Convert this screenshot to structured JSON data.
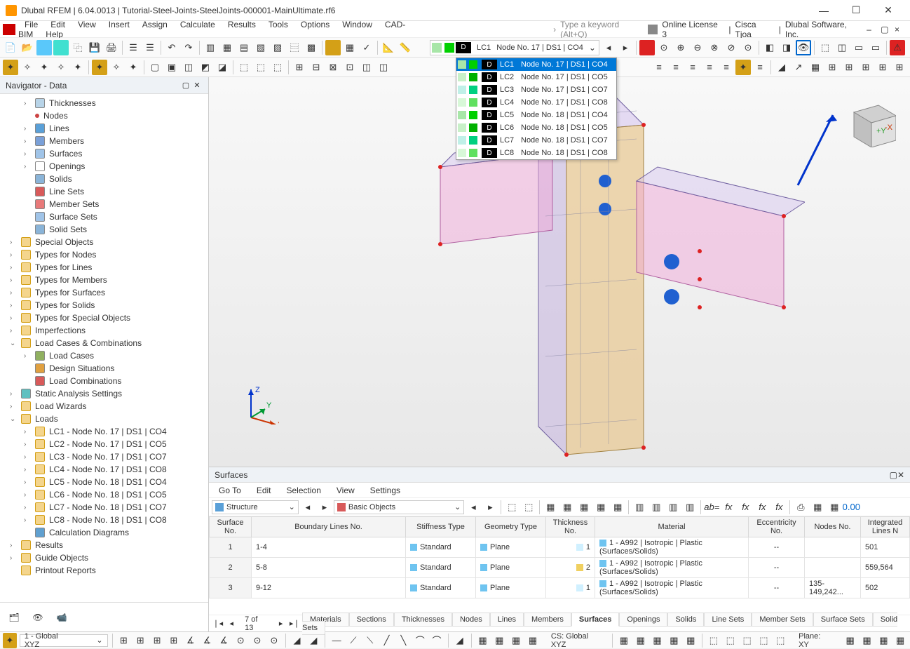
{
  "titlebar": {
    "title": "Dlubal RFEM | 6.04.0013 | Tutorial-Steel-Joints-SteelJoints-000001-MainUltimate.rf6"
  },
  "menubar": {
    "items": [
      "File",
      "Edit",
      "View",
      "Insert",
      "Assign",
      "Calculate",
      "Results",
      "Tools",
      "Options",
      "Window",
      "CAD-BIM",
      "Help"
    ],
    "search_placeholder": "Type a keyword (Alt+Q)",
    "license": "Online License 3",
    "user": "Cisca Tjoa",
    "company": "Dlubal Software, Inc."
  },
  "lc_selector": {
    "current_id": "LC1",
    "current_text": "Node No. 17 | DS1 | CO4",
    "options": [
      {
        "id": "LC1",
        "text": "Node No. 17 | DS1 | CO4",
        "sw1": "#a8e6a8",
        "sw2": "#00d000"
      },
      {
        "id": "LC2",
        "text": "Node No. 17 | DS1 | CO5",
        "sw1": "#c8f0c8",
        "sw2": "#00b000"
      },
      {
        "id": "LC3",
        "text": "Node No. 17 | DS1 | CO7",
        "sw1": "#c0f0e8",
        "sw2": "#00d080"
      },
      {
        "id": "LC4",
        "text": "Node No. 17 | DS1 | CO8",
        "sw1": "#d8f8d8",
        "sw2": "#60e060"
      },
      {
        "id": "LC5",
        "text": "Node No. 18 | DS1 | CO4",
        "sw1": "#a8e6a8",
        "sw2": "#00d000"
      },
      {
        "id": "LC6",
        "text": "Node No. 18 | DS1 | CO5",
        "sw1": "#c8f0c8",
        "sw2": "#00b000"
      },
      {
        "id": "LC7",
        "text": "Node No. 18 | DS1 | CO7",
        "sw1": "#c0f0e8",
        "sw2": "#00d080"
      },
      {
        "id": "LC8",
        "text": "Node No. 18 | DS1 | CO8",
        "sw1": "#d8f8d8",
        "sw2": "#60e060"
      }
    ]
  },
  "navigator": {
    "title": "Navigator - Data",
    "tree": [
      {
        "d": 2,
        "label": "Thicknesses",
        "chev": "›",
        "ic": "#b8d4e8"
      },
      {
        "d": 2,
        "label": "Nodes",
        "ic": "node"
      },
      {
        "d": 2,
        "label": "Lines",
        "chev": "›",
        "ic": "#5aa0d8"
      },
      {
        "d": 2,
        "label": "Members",
        "chev": "›",
        "ic": "#7aa0d8"
      },
      {
        "d": 2,
        "label": "Surfaces",
        "chev": "›",
        "ic": "#a0c4e8"
      },
      {
        "d": 2,
        "label": "Openings",
        "chev": "›",
        "ic": "#ffffff"
      },
      {
        "d": 2,
        "label": "Solids",
        "ic": "#8ab4d8"
      },
      {
        "d": 2,
        "label": "Line Sets",
        "ic": "#d85a5a"
      },
      {
        "d": 2,
        "label": "Member Sets",
        "ic": "#e87a7a"
      },
      {
        "d": 2,
        "label": "Surface Sets",
        "ic": "#a0c4e8"
      },
      {
        "d": 2,
        "label": "Solid Sets",
        "ic": "#8ab4d8"
      },
      {
        "d": 1,
        "label": "Special Objects",
        "chev": "›",
        "ic": "folder"
      },
      {
        "d": 1,
        "label": "Types for Nodes",
        "chev": "›",
        "ic": "folder"
      },
      {
        "d": 1,
        "label": "Types for Lines",
        "chev": "›",
        "ic": "folder"
      },
      {
        "d": 1,
        "label": "Types for Members",
        "chev": "›",
        "ic": "folder"
      },
      {
        "d": 1,
        "label": "Types for Surfaces",
        "chev": "›",
        "ic": "folder"
      },
      {
        "d": 1,
        "label": "Types for Solids",
        "chev": "›",
        "ic": "folder"
      },
      {
        "d": 1,
        "label": "Types for Special Objects",
        "chev": "›",
        "ic": "folder"
      },
      {
        "d": 1,
        "label": "Imperfections",
        "chev": "›",
        "ic": "folder"
      },
      {
        "d": 1,
        "label": "Load Cases & Combinations",
        "chev": "⌄",
        "ic": "folder"
      },
      {
        "d": 2,
        "label": "Load Cases",
        "chev": "›",
        "ic": "#90b060"
      },
      {
        "d": 2,
        "label": "Design Situations",
        "ic": "#e0a040"
      },
      {
        "d": 2,
        "label": "Load Combinations",
        "ic": "#d85a5a"
      },
      {
        "d": 1,
        "label": "Static Analysis Settings",
        "chev": "›",
        "ic": "#60c0c0"
      },
      {
        "d": 1,
        "label": "Load Wizards",
        "chev": "›",
        "ic": "folder"
      },
      {
        "d": 1,
        "label": "Loads",
        "chev": "⌄",
        "ic": "folder"
      },
      {
        "d": 2,
        "label": "LC1 - Node No. 17 | DS1 | CO4",
        "chev": "›",
        "ic": "folder"
      },
      {
        "d": 2,
        "label": "LC2 - Node No. 17 | DS1 | CO5",
        "chev": "›",
        "ic": "folder"
      },
      {
        "d": 2,
        "label": "LC3 - Node No. 17 | DS1 | CO7",
        "chev": "›",
        "ic": "folder"
      },
      {
        "d": 2,
        "label": "LC4 - Node No. 17 | DS1 | CO8",
        "chev": "›",
        "ic": "folder"
      },
      {
        "d": 2,
        "label": "LC5 - Node No. 18 | DS1 | CO4",
        "chev": "›",
        "ic": "folder"
      },
      {
        "d": 2,
        "label": "LC6 - Node No. 18 | DS1 | CO5",
        "chev": "›",
        "ic": "folder"
      },
      {
        "d": 2,
        "label": "LC7 - Node No. 18 | DS1 | CO7",
        "chev": "›",
        "ic": "folder"
      },
      {
        "d": 2,
        "label": "LC8 - Node No. 18 | DS1 | CO8",
        "chev": "›",
        "ic": "folder"
      },
      {
        "d": 2,
        "label": "Calculation Diagrams",
        "ic": "#60a0d0"
      },
      {
        "d": 1,
        "label": "Results",
        "chev": "›",
        "ic": "folder"
      },
      {
        "d": 1,
        "label": "Guide Objects",
        "chev": "›",
        "ic": "folder"
      },
      {
        "d": 1,
        "label": "Printout Reports",
        "ic": "folder"
      }
    ]
  },
  "surfaces": {
    "title": "Surfaces",
    "menus": [
      "Go To",
      "Edit",
      "Selection",
      "View",
      "Settings"
    ],
    "combo1": "Structure",
    "combo2": "Basic Objects",
    "headers": {
      "surface_no": "Surface No.",
      "boundary": "Boundary Lines No.",
      "stiffness": "Stiffness Type",
      "geometry": "Geometry Type",
      "thickness_no": "Thickness No.",
      "material": "Material",
      "eccentricity_no": "Eccentricity No.",
      "nodes_no": "Nodes No.",
      "integrated": "Integrated Lines N"
    },
    "rows": [
      {
        "no": "1",
        "boundary": "1-4",
        "stiffness": "Standard",
        "stiff_sw": "#6fc4f0",
        "geometry": "Plane",
        "geom_sw": "#6fc4f0",
        "thick": "1",
        "thick_sw": "#d0f0ff",
        "material": "1 - A992 | Isotropic | Plastic (Surfaces/Solids)",
        "mat_sw": "#6fc4f0",
        "ecc": "--",
        "nodes": "",
        "lines": "501"
      },
      {
        "no": "2",
        "boundary": "5-8",
        "stiffness": "Standard",
        "stiff_sw": "#6fc4f0",
        "geometry": "Plane",
        "geom_sw": "#6fc4f0",
        "thick": "2",
        "thick_sw": "#f0d060",
        "material": "1 - A992 | Isotropic | Plastic (Surfaces/Solids)",
        "mat_sw": "#6fc4f0",
        "ecc": "--",
        "nodes": "",
        "lines": "559,564"
      },
      {
        "no": "3",
        "boundary": "9-12",
        "stiffness": "Standard",
        "stiff_sw": "#6fc4f0",
        "geometry": "Plane",
        "geom_sw": "#6fc4f0",
        "thick": "1",
        "thick_sw": "#d0f0ff",
        "material": "1 - A992 | Isotropic | Plastic (Surfaces/Solids)",
        "mat_sw": "#6fc4f0",
        "ecc": "--",
        "nodes": "135-149,242...",
        "lines": "502"
      }
    ],
    "pager": {
      "page": "7 of 13",
      "tabs": [
        "Materials",
        "Sections",
        "Thicknesses",
        "Nodes",
        "Lines",
        "Members",
        "Surfaces",
        "Openings",
        "Solids",
        "Line Sets",
        "Member Sets",
        "Surface Sets",
        "Solid Sets"
      ],
      "active_tab": "Surfaces"
    }
  },
  "statusbar": {
    "cs_combo": "1 - Global XYZ",
    "cs_label": "CS: Global XYZ",
    "plane_label": "Plane: XY"
  }
}
